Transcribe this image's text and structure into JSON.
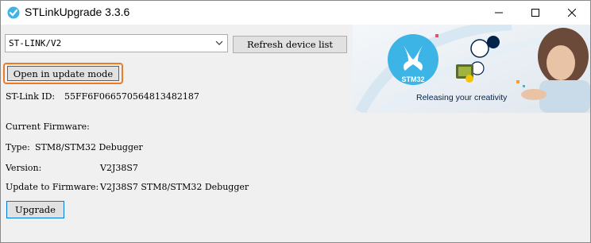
{
  "window": {
    "title": "STLinkUpgrade 3.3.6",
    "controls": {
      "minimize": "─",
      "maximize": "☐",
      "close": "✕"
    }
  },
  "device": {
    "selected": "ST-LINK/V2",
    "refresh_label": "Refresh device list",
    "open_update_label": "Open in update mode"
  },
  "info": {
    "stlink_id_label": "ST-Link ID:",
    "stlink_id_value": "55FF6F066570564813482187",
    "current_firmware_label": "Current Firmware:",
    "type_label": "Type:",
    "type_value": "STM8/STM32 Debugger",
    "version_label": "Version:",
    "version_value": "V2J38S7",
    "update_to_label": "Update to Firmware:",
    "update_to_value": "V2J38S7 STM8/STM32 Debugger"
  },
  "actions": {
    "upgrade_label": "Upgrade"
  },
  "banner": {
    "logo_text": "STM32",
    "tagline": "Releasing your creativity"
  },
  "colors": {
    "highlight": "#ee7b22",
    "focus": "#0078d7",
    "brand": "#03234b",
    "logo_blue": "#3cb4e6"
  }
}
